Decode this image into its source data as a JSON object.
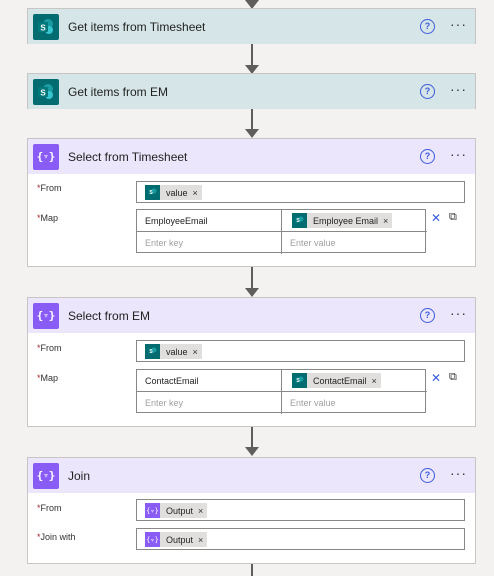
{
  "cards": {
    "get_timesheet": {
      "title": "Get items from Timesheet",
      "help": "?",
      "more": "···"
    },
    "get_em": {
      "title": "Get items from EM",
      "help": "?",
      "more": "···"
    },
    "select_timesheet": {
      "title": "Select from Timesheet",
      "help": "?",
      "more": "···",
      "from_label": "From",
      "from_token": "value",
      "map_label": "Map",
      "map_key": "EmployeeEmail",
      "map_value_token": "Employee Email",
      "key_placeholder": "Enter key",
      "value_placeholder": "Enter value"
    },
    "select_em": {
      "title": "Select from EM",
      "help": "?",
      "more": "···",
      "from_label": "From",
      "from_token": "value",
      "map_label": "Map",
      "map_key": "ContactEmail",
      "map_value_token": "ContactEmail",
      "key_placeholder": "Enter key",
      "value_placeholder": "Enter value"
    },
    "join": {
      "title": "Join",
      "help": "?",
      "more": "···",
      "from_label": "From",
      "from_token": "Output",
      "join_with_label": "Join with",
      "join_with_token": "Output"
    }
  },
  "required_marker": "*",
  "remove_glyph": "×",
  "icons": {
    "sharepoint": "sharepoint-icon",
    "select": "data-operation-icon",
    "delete": "delete-icon",
    "switch": "switch-map-icon"
  },
  "colors": {
    "sharepoint": "#036c70",
    "select": "#8a5cf6",
    "sp_header": "#d6e6e8",
    "select_header": "#ebe6fc",
    "link": "#3b5bdb"
  }
}
